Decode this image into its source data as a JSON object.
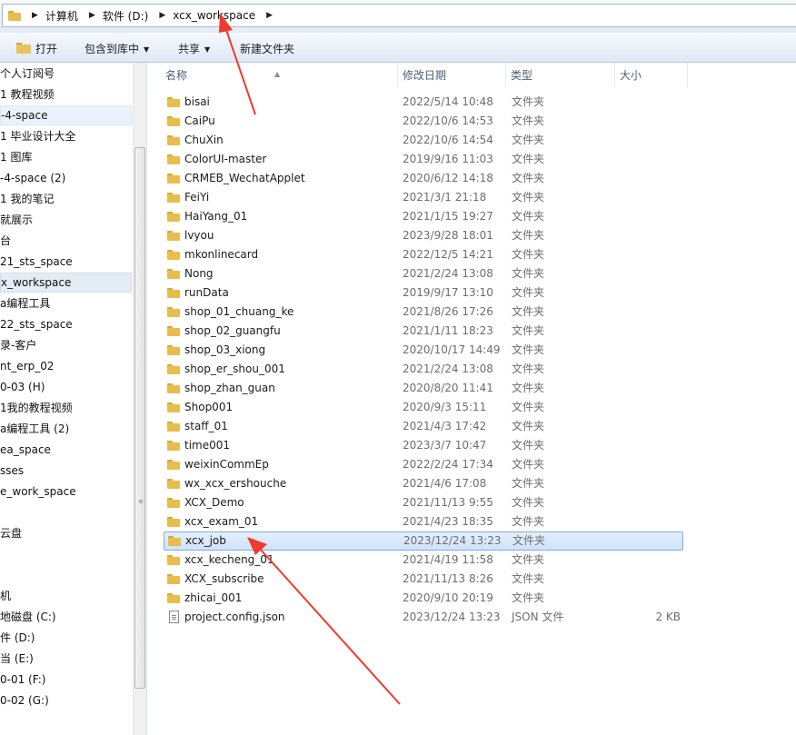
{
  "address": {
    "crumbs": [
      "计算机",
      "软件 (D:)",
      "xcx_workspace"
    ]
  },
  "toolbar": {
    "open": "打开",
    "include_library": "包含到库中",
    "share": "共享",
    "new_folder": "新建文件夹"
  },
  "nav": {
    "items": [
      "个人订阅号",
      "1 教程视频",
      "-4-space",
      "1 毕业设计大全",
      "1 图库",
      "-4-space (2)",
      "1 我的笔记",
      "就展示",
      "台",
      "21_sts_space",
      "x_workspace",
      "a编程工具",
      "22_sts_space",
      "录-客户",
      "nt_erp_02",
      "0-03 (H)",
      "1我的教程视频",
      "a编程工具 (2)",
      "ea_space",
      "sses",
      "e_work_space",
      "",
      "云盘",
      "",
      "",
      "机",
      "地磁盘 (C:)",
      "件 (D:)",
      "当 (E:)",
      "0-01 (F:)",
      "0-02 (G:)"
    ]
  },
  "columns": {
    "name": "名称",
    "date": "修改日期",
    "type": "类型",
    "size": "大小"
  },
  "files": [
    {
      "name": "bisai",
      "date": "2022/5/14 10:48",
      "type": "文件夹",
      "size": "",
      "icon": "folder-icon"
    },
    {
      "name": "CaiPu",
      "date": "2022/10/6 14:53",
      "type": "文件夹",
      "size": "",
      "icon": "folder-icon"
    },
    {
      "name": "ChuXin",
      "date": "2022/10/6 14:54",
      "type": "文件夹",
      "size": "",
      "icon": "folder-icon"
    },
    {
      "name": "ColorUI-master",
      "date": "2019/9/16 11:03",
      "type": "文件夹",
      "size": "",
      "icon": "folder-icon"
    },
    {
      "name": "CRMEB_WechatApplet",
      "date": "2020/6/12 14:18",
      "type": "文件夹",
      "size": "",
      "icon": "folder-icon"
    },
    {
      "name": "FeiYi",
      "date": "2021/3/1 21:18",
      "type": "文件夹",
      "size": "",
      "icon": "folder-icon"
    },
    {
      "name": "HaiYang_01",
      "date": "2021/1/15 19:27",
      "type": "文件夹",
      "size": "",
      "icon": "folder-icon"
    },
    {
      "name": "lvyou",
      "date": "2023/9/28 18:01",
      "type": "文件夹",
      "size": "",
      "icon": "folder-icon"
    },
    {
      "name": "mkonlinecard",
      "date": "2022/12/5 14:21",
      "type": "文件夹",
      "size": "",
      "icon": "folder-icon"
    },
    {
      "name": "Nong",
      "date": "2021/2/24 13:08",
      "type": "文件夹",
      "size": "",
      "icon": "folder-icon"
    },
    {
      "name": "runData",
      "date": "2019/9/17 13:10",
      "type": "文件夹",
      "size": "",
      "icon": "folder-icon"
    },
    {
      "name": "shop_01_chuang_ke",
      "date": "2021/8/26 17:26",
      "type": "文件夹",
      "size": "",
      "icon": "folder-icon"
    },
    {
      "name": "shop_02_guangfu",
      "date": "2021/1/11 18:23",
      "type": "文件夹",
      "size": "",
      "icon": "folder-icon"
    },
    {
      "name": "shop_03_xiong",
      "date": "2020/10/17 14:49",
      "type": "文件夹",
      "size": "",
      "icon": "folder-icon"
    },
    {
      "name": "shop_er_shou_001",
      "date": "2021/2/24 13:08",
      "type": "文件夹",
      "size": "",
      "icon": "folder-icon"
    },
    {
      "name": "shop_zhan_guan",
      "date": "2020/8/20 11:41",
      "type": "文件夹",
      "size": "",
      "icon": "folder-icon"
    },
    {
      "name": "Shop001",
      "date": "2020/9/3 15:11",
      "type": "文件夹",
      "size": "",
      "icon": "folder-icon"
    },
    {
      "name": "staff_01",
      "date": "2021/4/3 17:42",
      "type": "文件夹",
      "size": "",
      "icon": "folder-icon"
    },
    {
      "name": "time001",
      "date": "2023/3/7 10:47",
      "type": "文件夹",
      "size": "",
      "icon": "folder-icon"
    },
    {
      "name": "weixinCommEp",
      "date": "2022/2/24 17:34",
      "type": "文件夹",
      "size": "",
      "icon": "folder-icon"
    },
    {
      "name": "wx_xcx_ershouche",
      "date": "2021/4/6 17:08",
      "type": "文件夹",
      "size": "",
      "icon": "folder-icon"
    },
    {
      "name": "XCX_Demo",
      "date": "2021/11/13 9:55",
      "type": "文件夹",
      "size": "",
      "icon": "folder-icon"
    },
    {
      "name": "xcx_exam_01",
      "date": "2021/4/23 18:35",
      "type": "文件夹",
      "size": "",
      "icon": "folder-icon"
    },
    {
      "name": "xcx_job",
      "date": "2023/12/24 13:23",
      "type": "文件夹",
      "size": "",
      "icon": "folder-icon"
    },
    {
      "name": "xcx_kecheng_01",
      "date": "2021/4/19 11:58",
      "type": "文件夹",
      "size": "",
      "icon": "folder-icon"
    },
    {
      "name": "XCX_subscribe",
      "date": "2021/11/13 8:26",
      "type": "文件夹",
      "size": "",
      "icon": "folder-icon"
    },
    {
      "name": "zhicai_001",
      "date": "2020/9/10 20:19",
      "type": "文件夹",
      "size": "",
      "icon": "folder-icon"
    },
    {
      "name": "project.config.json",
      "date": "2023/12/24 13:23",
      "type": "JSON 文件",
      "size": "2 KB",
      "icon": "json-file-icon"
    }
  ],
  "colors": {
    "annotation_arrow": "#ee3b2f",
    "selection_border": "#84acdd",
    "folder": "#e8bd4d"
  }
}
